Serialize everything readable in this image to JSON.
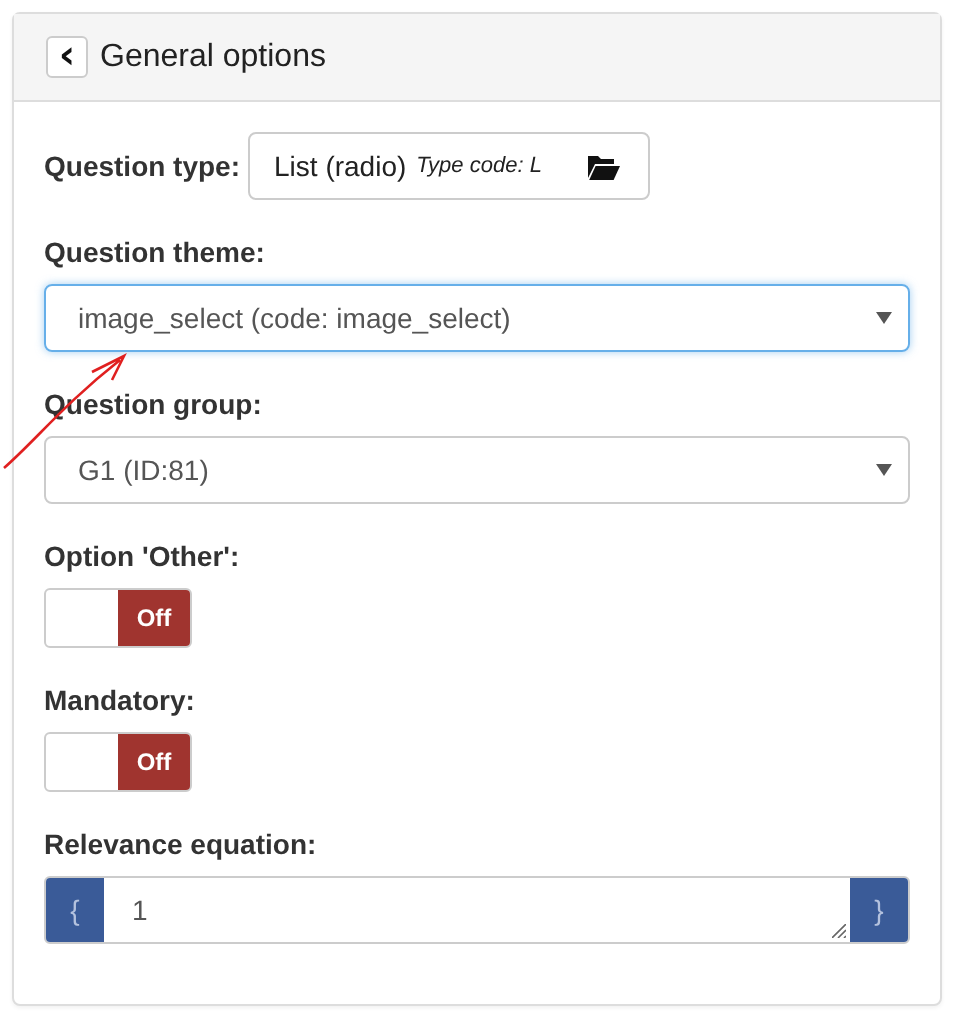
{
  "panel": {
    "title": "General options",
    "back_icon": "‹"
  },
  "fields": [
    {
      "kind": "type",
      "label": "Question type:",
      "value": "List (radio)",
      "hint": "Type code: L"
    },
    {
      "kind": "select",
      "label": "Question theme:",
      "value": "image_select (code: image_select)",
      "focused": true
    },
    {
      "kind": "select",
      "label": "Question group:",
      "value": "G1 (ID:81)",
      "focused": false
    },
    {
      "kind": "toggle",
      "label": "Option 'Other':",
      "on": false,
      "state_text": "Off"
    },
    {
      "kind": "toggle",
      "label": "Mandatory:",
      "on": false,
      "state_text": "Off"
    },
    {
      "kind": "equation",
      "label": "Relevance equation:",
      "value": "1",
      "open_brace": "{",
      "close_brace": "}"
    }
  ]
}
